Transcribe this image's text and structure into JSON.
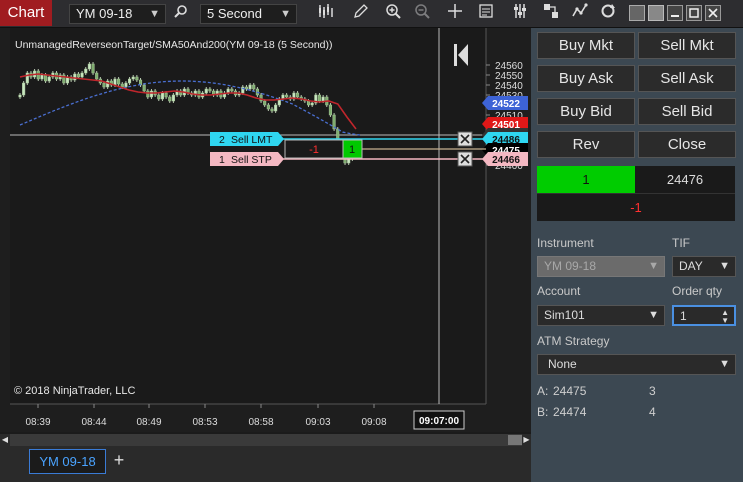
{
  "toolbar": {
    "chart_tab": "Chart",
    "instrument": "YM 09-18",
    "interval": "5 Second",
    "icons": [
      "search-icon",
      "bar-type-icon",
      "pencil-icon",
      "zoom-in-icon",
      "zoom-out-icon",
      "crosshair-icon",
      "data-box-icon",
      "properties-icon",
      "strategies-icon",
      "indicators-icon",
      "refresh-icon",
      "tile-icon",
      "restore-icon",
      "maximize-icon",
      "close-icon"
    ]
  },
  "chart": {
    "title": "UnmanagedReverseonTarget/SMA50And200(YM 09-18 (5 Second))",
    "copyright": "© 2018 NinjaTrader, LLC",
    "price_ticks": [
      "24560",
      "24550",
      "24540",
      "24530",
      "24520",
      "24510",
      "24500",
      "24490",
      "24480",
      "24470",
      "24460"
    ],
    "time_ticks": [
      "08:39",
      "08:44",
      "08:49",
      "08:53",
      "08:58",
      "09:03",
      "09:08"
    ],
    "crosshair_time": "09:07:00",
    "price_markers": {
      "sma_blue": "24522",
      "sma_red": "24501",
      "horizontal": "24490",
      "limit": "24486",
      "last": "24475",
      "stop": "24466"
    },
    "orders": {
      "limit_qty": "2",
      "limit_label": "Sell LMT",
      "stop_qty": "1",
      "stop_label": "Sell STP",
      "position_pnl": "-1",
      "position_qty": "1"
    },
    "colors": {
      "blue_sma": "#4a6fd1",
      "red_sma": "#c0262c",
      "limit": "#2fd6f0",
      "stop": "#f4b8c2",
      "up_candle": "#c8e6c0",
      "down_candle": "#e8e8e8"
    }
  },
  "tabs": {
    "active": "YM 09-18",
    "add": "+"
  },
  "panel": {
    "buttons": {
      "buy_mkt": "Buy Mkt",
      "sell_mkt": "Sell Mkt",
      "buy_ask": "Buy Ask",
      "sell_ask": "Sell Ask",
      "buy_bid": "Buy Bid",
      "sell_bid": "Sell Bid",
      "rev": "Rev",
      "close": "Close"
    },
    "position": {
      "qty": "1",
      "avg_price": "24476",
      "pnl": "-1"
    },
    "instrument_label": "Instrument",
    "instrument_value": "YM 09-18",
    "tif_label": "TIF",
    "tif_value": "DAY",
    "account_label": "Account",
    "account_value": "Sim101",
    "order_qty_label": "Order qty",
    "order_qty_value": "1",
    "atm_label": "ATM Strategy",
    "atm_value": "None",
    "ask_label": "A:",
    "ask_price": "24475",
    "ask_size": "3",
    "bid_label": "B:",
    "bid_price": "24474",
    "bid_size": "4"
  }
}
